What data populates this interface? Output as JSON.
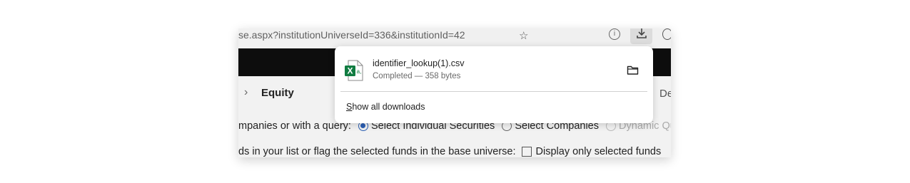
{
  "browser": {
    "url_fragment": "se.aspx?institutionUniverseId=336&institutionId=42",
    "icons": [
      "star-icon",
      "info-icon",
      "download-icon",
      "profile-icon"
    ]
  },
  "page": {
    "breadcrumb": "Equity",
    "right_label": "De",
    "row1": {
      "prefix": "mpanies or with a query:",
      "options": [
        {
          "label": "Select Individual Securities",
          "selected": true,
          "enabled": true
        },
        {
          "label": "Select Companies",
          "selected": false,
          "enabled": true
        },
        {
          "label": "Dynamic Query",
          "selected": false,
          "enabled": false
        }
      ]
    },
    "row2": {
      "prefix": "ds in your list or flag the selected funds in the base universe:",
      "checkbox_label": "Display only selected funds",
      "checked": false
    }
  },
  "downloads": {
    "file_name": "identifier_lookup(1).csv",
    "status": "Completed — 358 bytes",
    "show_all_first_letter": "S",
    "show_all_rest": "how all downloads",
    "file_icon": "excel-file-icon",
    "folder_icon": "folder-icon",
    "colors": {
      "excel_green": "#107c41",
      "radio_blue": "#2b5fb4"
    }
  }
}
